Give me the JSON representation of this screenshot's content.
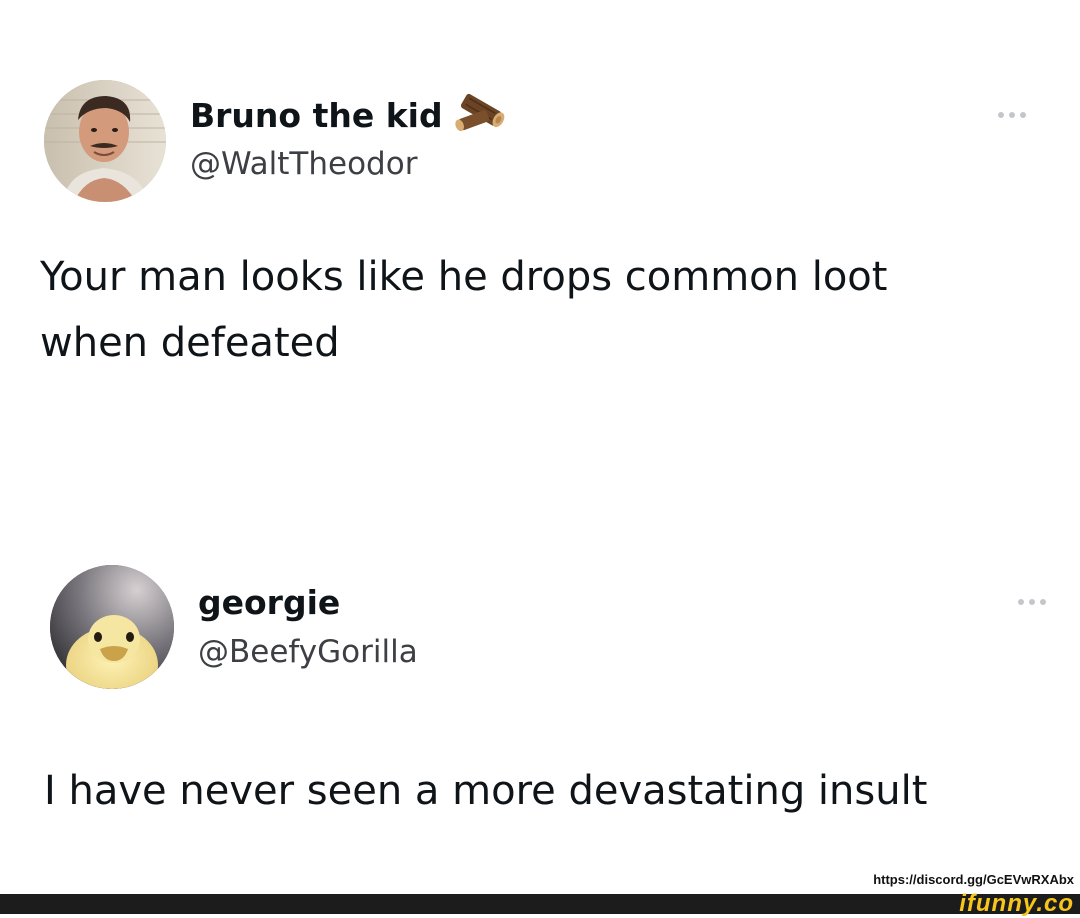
{
  "tweets": [
    {
      "display_name": "Bruno the kid",
      "name_emoji": "log-wood-emoji",
      "handle": "@WaltTheodor",
      "text": "Your man looks like he drops common loot\nwhen defeated",
      "avatar": "man-with-mustache-avatar",
      "more_icon": "more-options-icon"
    },
    {
      "display_name": "georgie",
      "handle": "@BeefyGorilla",
      "text": "I have never seen a more devastating insult",
      "avatar": "duckling-avatar",
      "more_icon": "more-options-icon"
    }
  ],
  "footer": {
    "discord_link": "https://discord.gg/GcEVwRXAbx",
    "watermark": "ifunny.co"
  },
  "colors": {
    "text_primary": "#0f1419",
    "handle": "#3d3f44",
    "watermark": "#f7c51b"
  }
}
